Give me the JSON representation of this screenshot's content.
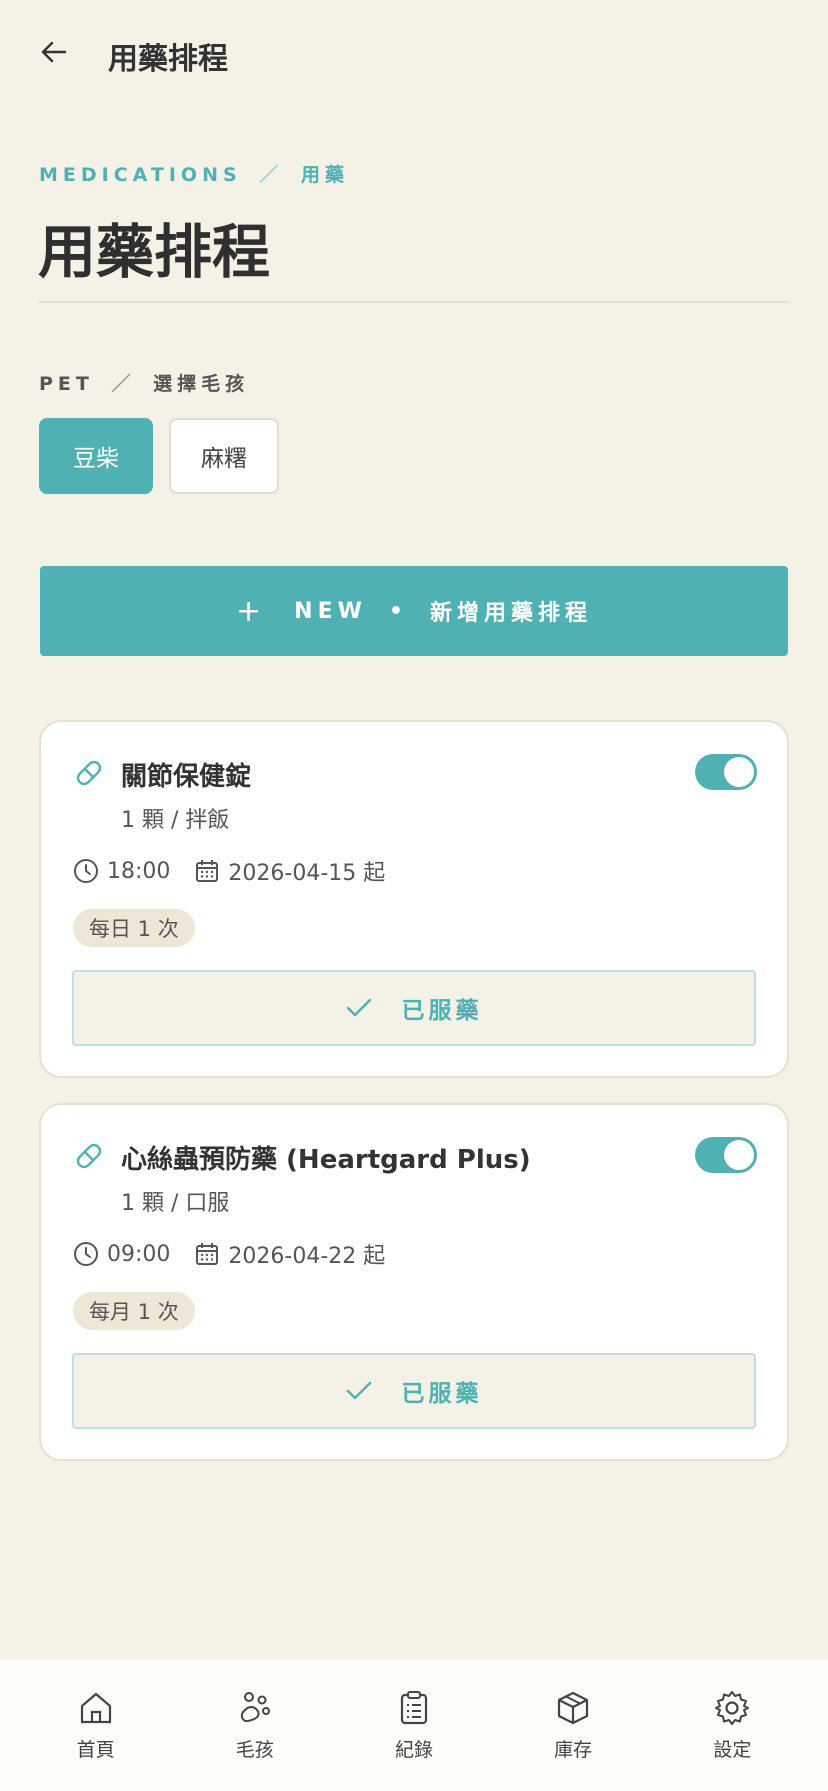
{
  "header": {
    "title": "用藥排程"
  },
  "breadcrumb": {
    "en": "MEDICATIONS",
    "separator": "／",
    "zh": "用藥"
  },
  "page_title": "用藥排程",
  "pet_selector": {
    "label_en": "PET",
    "separator": "／",
    "label_zh": "選擇毛孩",
    "pets": [
      {
        "name": "豆柴",
        "selected": true
      },
      {
        "name": "麻糬",
        "selected": false
      }
    ]
  },
  "new_button": {
    "plus": "+",
    "en": "NEW",
    "dot": "•",
    "zh": "新增用藥排程"
  },
  "medications": [
    {
      "name": "關節保健錠",
      "dosage": "1 顆 / 拌飯",
      "time": "18:00",
      "start_date": "2026-04-15 起",
      "frequency": "每日 1 次",
      "enabled": true,
      "taken_label": "已服藥"
    },
    {
      "name": "心絲蟲預防藥 (Heartgard Plus)",
      "dosage": "1 顆 / 口服",
      "time": "09:00",
      "start_date": "2026-04-22 起",
      "frequency": "每月 1 次",
      "enabled": true,
      "taken_label": "已服藥"
    }
  ],
  "bottom_nav": [
    {
      "label": "首頁",
      "icon": "home-icon"
    },
    {
      "label": "毛孩",
      "icon": "paw-icon"
    },
    {
      "label": "紀錄",
      "icon": "clipboard-icon"
    },
    {
      "label": "庫存",
      "icon": "box-icon"
    },
    {
      "label": "設定",
      "icon": "gear-icon"
    }
  ],
  "colors": {
    "accent": "#4FB1B3",
    "background": "#F4F1E7",
    "card": "#FFFFFF"
  }
}
